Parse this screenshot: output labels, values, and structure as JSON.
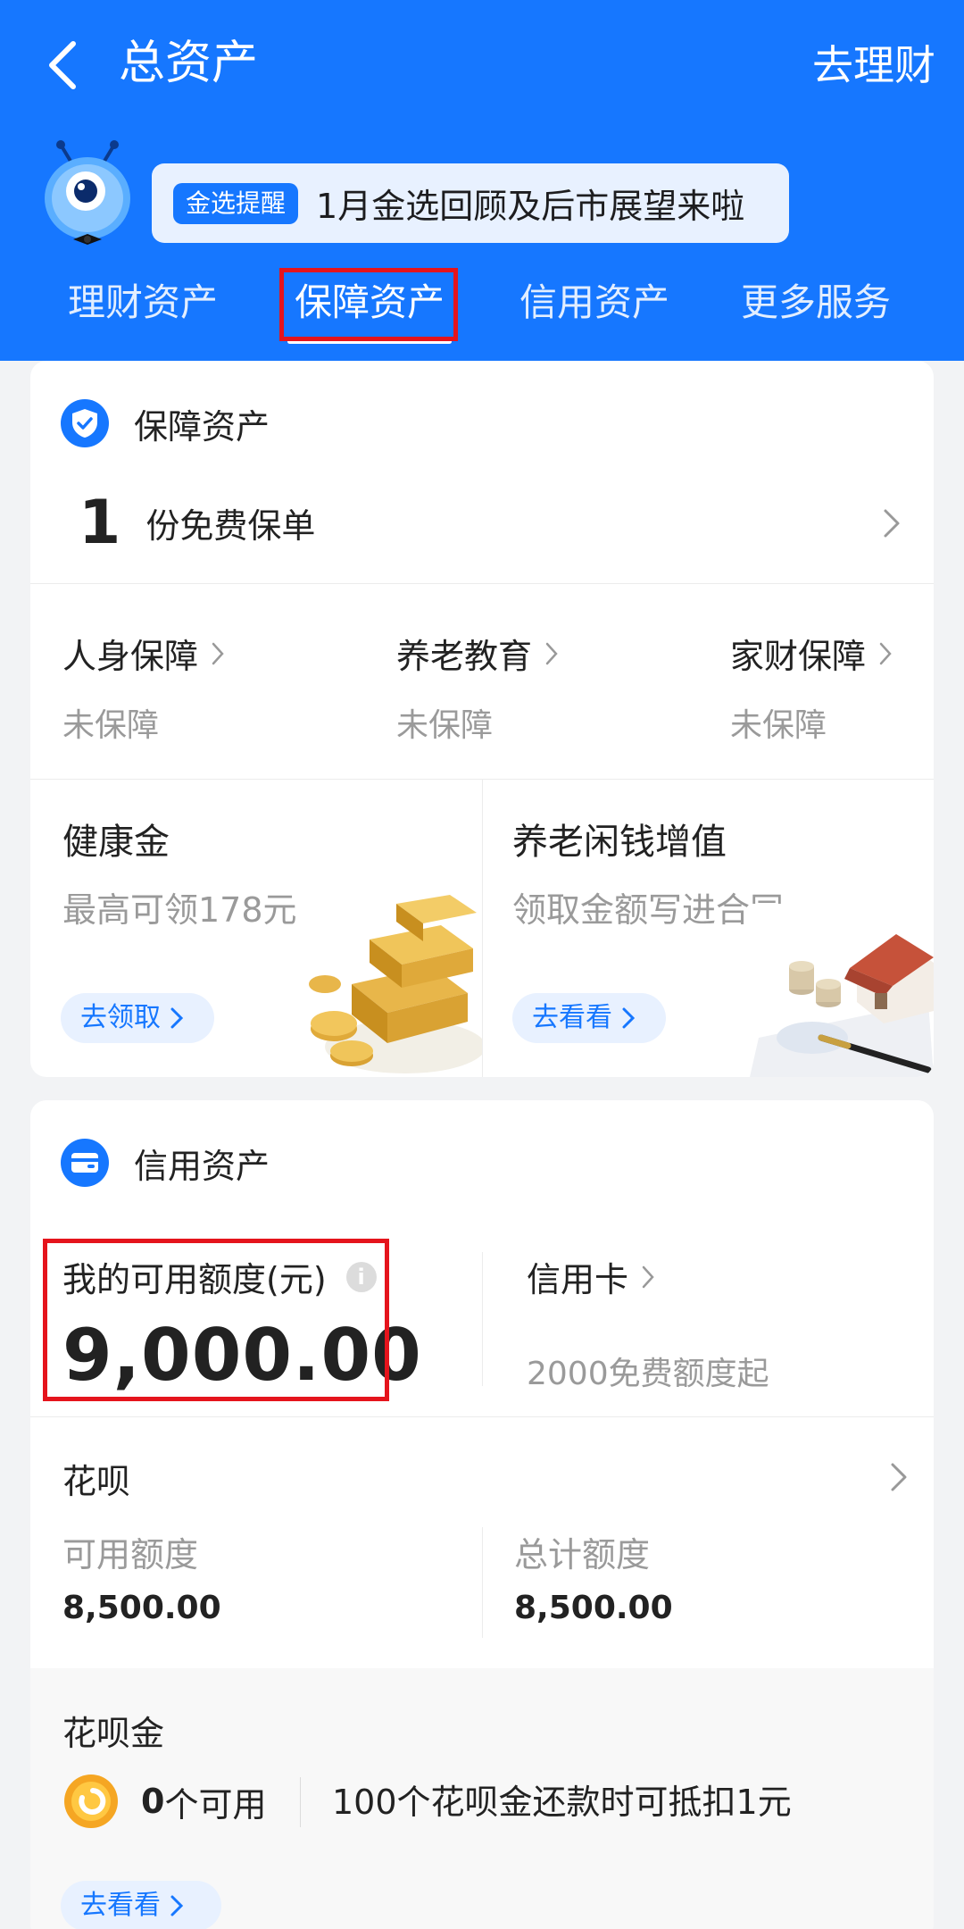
{
  "header": {
    "title": "总资产",
    "right_action": "去理财",
    "notice_tag": "金选提醒",
    "notice_text": "1月金选回顾及后市展望来啦"
  },
  "tabs": [
    {
      "label": "理财资产"
    },
    {
      "label": "保障资产"
    },
    {
      "label": "信用资产"
    },
    {
      "label": "更多服务"
    }
  ],
  "insurance": {
    "title": "保障资产",
    "policy_count": "1",
    "policy_label": "份免费保单",
    "categories": [
      {
        "label": "人身保障",
        "status": "未保障"
      },
      {
        "label": "养老教育",
        "status": "未保障"
      },
      {
        "label": "家财保障",
        "status": "未保障"
      }
    ],
    "promos": [
      {
        "title": "健康金",
        "subtitle": "最高可领178元",
        "button": "去领取"
      },
      {
        "title": "养老闲钱增值",
        "subtitle": "领取金额写进合同",
        "button": "去看看"
      }
    ]
  },
  "credit": {
    "title": "信用资产",
    "available_label": "我的可用额度(元)",
    "available_value": "9,000.00",
    "credit_card_label": "信用卡",
    "credit_card_sub": "2000免费额度起",
    "huabei": {
      "title": "花呗",
      "available_label": "可用额度",
      "available_value": "8,500.00",
      "total_label": "总计额度",
      "total_value": "8,500.00"
    },
    "huabei_gold": {
      "title": "花呗金",
      "count": "0",
      "count_label": "个可用",
      "desc": "100个花呗金还款时可抵扣1元",
      "button": "去看看"
    }
  },
  "colors": {
    "brand_blue": "#1677ff",
    "highlight_red": "#e5141c",
    "gold": "#f5a623"
  }
}
